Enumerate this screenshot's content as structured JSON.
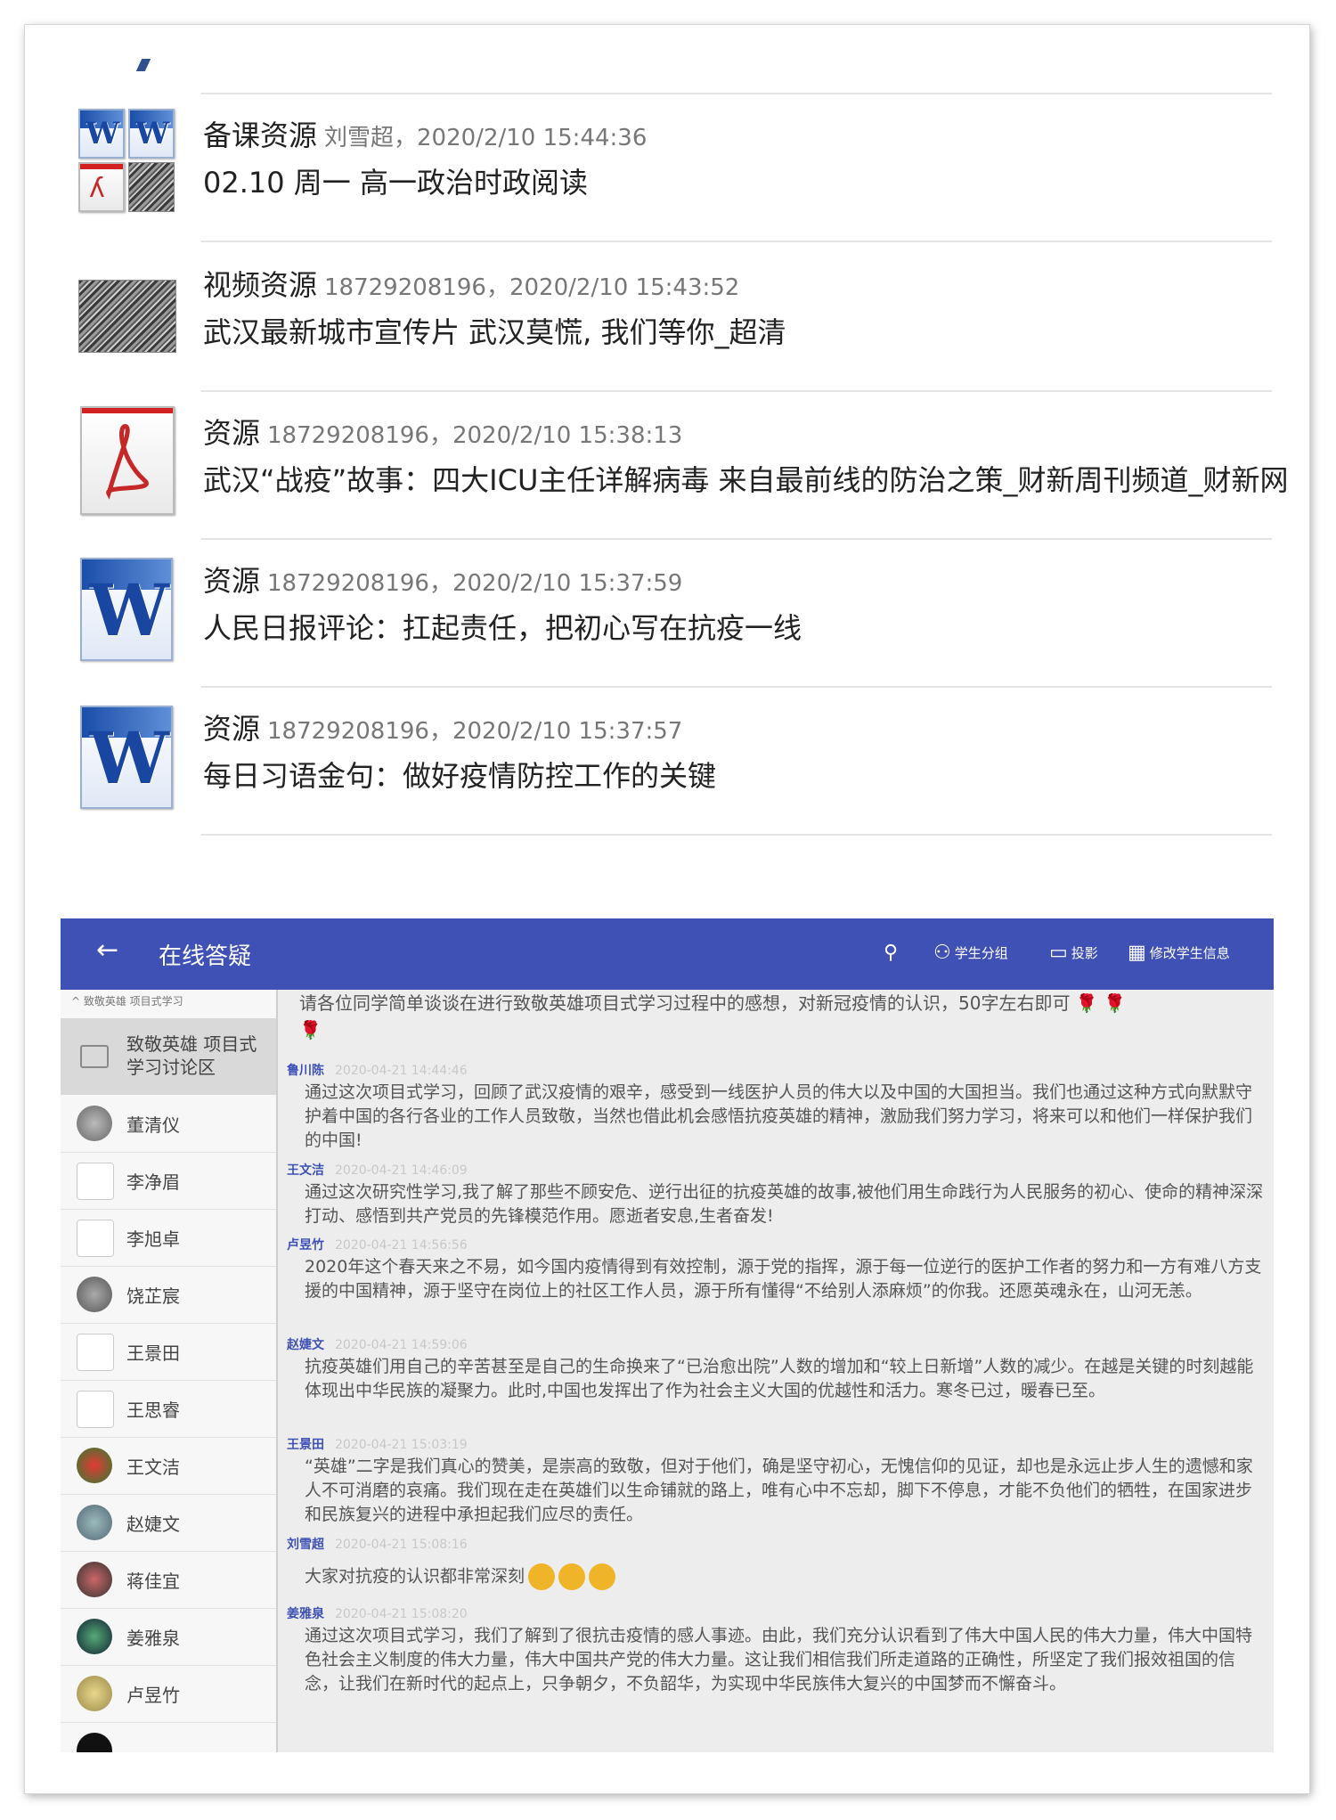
{
  "resources": [
    {
      "category": "备课资源",
      "meta": "刘雪超，2020/2/10 15:44:36",
      "title": "02.10 周一 高一政治时政阅读",
      "icon": "file-bundle-icon"
    },
    {
      "category": "视频资源",
      "meta": "18729208196，2020/2/10 15:43:52",
      "title": "武汉最新城市宣传片 武汉莫慌, 我们等你_超清",
      "icon": "video-thumbnail-icon"
    },
    {
      "category": "资源",
      "meta": "18729208196，2020/2/10 15:38:13",
      "title": "武汉“战疫”故事：四大ICU主任详解病毒 来自最前线的防治之策_财新周刊频道_财新网",
      "icon": "pdf-icon"
    },
    {
      "category": "资源",
      "meta": "18729208196，2020/2/10 15:37:59",
      "title": "人民日报评论：扛起责任，把初心写在抗疫一线",
      "icon": "word-icon"
    },
    {
      "category": "资源",
      "meta": "18729208196，2020/2/10 15:37:57",
      "title": "每日习语金句：做好疫情防控工作的关键",
      "icon": "word-icon"
    }
  ],
  "app": {
    "title": "在线答疑",
    "actions": {
      "group": "学生分组",
      "project": "投影",
      "edit": "修改学生信息"
    },
    "colors": {
      "appbar": "#3f51b5",
      "author": "#3f51b5"
    }
  },
  "sidebar": {
    "header": "^ 致敬英雄 项目式学习",
    "group_label": "致敬英雄 项目式学习讨论区",
    "students": [
      "董清仪",
      "李净眉",
      "李旭卓",
      "饶芷宸",
      "王景田",
      "王思睿",
      "王文洁",
      "赵婕文",
      "蒋佳宜",
      "姜雅泉",
      "卢昱竹"
    ]
  },
  "chat": {
    "prompt": "请各位同学简单谈谈在进行致敬英雄项目式学习过程中的感想，对新冠疫情的认识，50字左右即可",
    "messages": [
      {
        "author": "鲁川陈",
        "time": "2020-04-21 14:44:46",
        "text": "通过这次项目式学习，回顾了武汉疫情的艰辛，感受到一线医护人员的伟大以及中国的大国担当。我们也通过这种方式向默默守护着中国的各行各业的工作人员致敬，当然也借此机会感悟抗疫英雄的精神，激励我们努力学习，将来可以和他们一样保护我们的中国!"
      },
      {
        "author": "王文洁",
        "time": "2020-04-21 14:46:09",
        "text": "通过这次研究性学习,我了解了那些不顾安危、逆行出征的抗疫英雄的故事,被他们用生命践行为人民服务的初心、使命的精神深深打动、感悟到共产党员的先锋模范作用。愿逝者安息,生者奋发!"
      },
      {
        "author": "卢昱竹",
        "time": "2020-04-21 14:56:56",
        "text": "2020年这个春天来之不易，如今国内疫情得到有效控制，源于党的指挥，源于每一位逆行的医护工作者的努力和一方有难八方支援的中国精神，源于坚守在岗位上的社区工作人员，源于所有懂得“不给别人添麻烦”的你我。还愿英魂永在，山河无恙。"
      },
      {
        "author": "赵婕文",
        "time": "2020-04-21 14:59:06",
        "text": "抗疫英雄们用自己的辛苦甚至是自己的生命换来了“已治愈出院”人数的增加和“较上日新增”人数的减少。在越是关键的时刻越能体现出中华民族的凝聚力。此时,中国也发挥出了作为社会主义大国的优越性和活力。寒冬已过，暖春已至。"
      },
      {
        "author": "王景田",
        "time": "2020-04-21 15:03:19",
        "text": "“英雄”二字是我们真心的赞美，是崇高的致敬，但对于他们，确是坚守初心，无愧信仰的见证，却也是永远止步人生的遗憾和家人不可消磨的哀痛。我们现在走在英雄们以生命铺就的路上，唯有心中不忘却，脚下不停息，才能不负他们的牺牲，在国家进步和民族复兴的进程中承担起我们应尽的责任。"
      },
      {
        "author": "刘雪超",
        "time": "2020-04-21 15:08:16",
        "text": "大家对抗疫的认识都非常深刻"
      },
      {
        "author": "姜雅泉",
        "time": "2020-04-21 15:08:20",
        "text": "通过这次项目式学习，我们了解到了很抗击疫情的感人事迹。由此，我们充分认识看到了伟大中国人民的伟大力量，伟大中国特色社会主义制度的伟大力量，伟大中国共产党的伟大力量。这让我们相信我们所走道路的正确性，所坚定了我们报效祖国的信念，让我们在新时代的起点上，只争朝夕，不负韶华，为实现中华民族伟大复兴的中国梦而不懈奋斗。"
      }
    ]
  }
}
